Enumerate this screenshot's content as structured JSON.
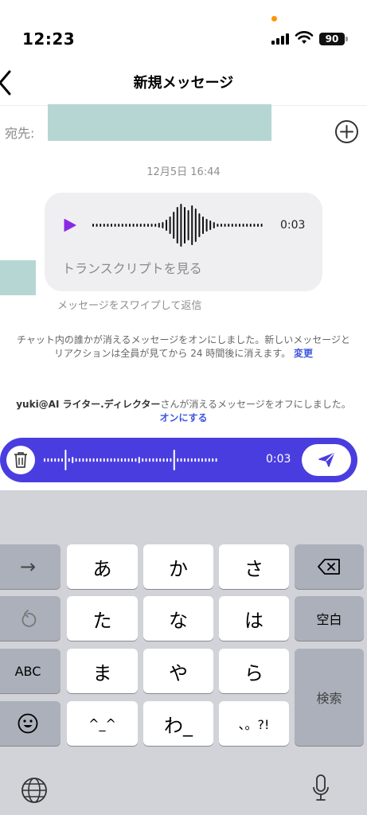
{
  "status_bar": {
    "time": "12:23",
    "battery": "90"
  },
  "nav": {
    "title": "新規メッセージ"
  },
  "recipient": {
    "label": "宛先:"
  },
  "conversation": {
    "date": "12月5日 16:44",
    "voice_message": {
      "duration": "0:03",
      "transcript_link": "トランスクリプトを見る"
    },
    "swipe_hint": "メッセージをスワイプして返信",
    "system_message_1": {
      "text": "チャット内の誰かが消えるメッセージをオンにしました。新しいメッセージとリアクションは全員が見てから 24 時間後に消えます。",
      "action": "変更"
    },
    "system_message_2": {
      "name": "yuki@AI ライター.ディレクター",
      "text": "さんが消えるメッセージをオフにしました。",
      "action": "オンにする"
    }
  },
  "recording": {
    "duration": "0:03"
  },
  "keyboard": {
    "keys": {
      "arrow": "→",
      "a": "あ",
      "ka": "か",
      "sa": "さ",
      "ta": "た",
      "na": "な",
      "ha": "は",
      "space": "空白",
      "abc": "ABC",
      "ma": "ま",
      "ya": "や",
      "ra": "ら",
      "search": "検索",
      "kaomoji": "^_^",
      "wa": "わ_",
      "punct": "、。?!"
    }
  },
  "colors": {
    "accent": "#4a3de0",
    "play": "#8a2be2",
    "link": "#3d56e0",
    "redacted": "#b6d6d3"
  }
}
